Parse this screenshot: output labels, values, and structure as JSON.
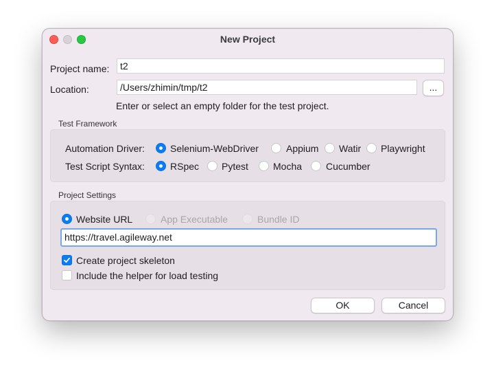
{
  "window": {
    "title": "New Project"
  },
  "form": {
    "project_name_label": "Project name:",
    "project_name_value": "t2",
    "location_label": "Location:",
    "location_value": "/Users/zhimin/tmp/t2",
    "browse_label": "...",
    "hint": "Enter or select an empty folder for the test project."
  },
  "test_framework": {
    "title": "Test Framework",
    "driver_label": "Automation Driver:",
    "drivers": [
      "Selenium-WebDriver",
      "Appium",
      "Watir",
      "Playwright"
    ],
    "selected_driver": "Selenium-WebDriver",
    "syntax_label": "Test Script Syntax:",
    "syntaxes": [
      "RSpec",
      "Pytest",
      "Mocha",
      "Cucumber"
    ],
    "selected_syntax": "RSpec"
  },
  "project_settings": {
    "title": "Project Settings",
    "targets": [
      {
        "label": "Website URL",
        "enabled": true,
        "selected": true
      },
      {
        "label": "App Executable",
        "enabled": false,
        "selected": false
      },
      {
        "label": "Bundle ID",
        "enabled": false,
        "selected": false
      }
    ],
    "url_value": "https://travel.agileway.net",
    "create_skeleton_label": "Create project skeleton",
    "create_skeleton_checked": true,
    "load_helper_label": "Include the helper for load testing",
    "load_helper_checked": false
  },
  "buttons": {
    "ok": "OK",
    "cancel": "Cancel"
  },
  "colors": {
    "accent": "#0a7cf6",
    "dialog_bg": "#f0eaf0",
    "close": "#ff5f57",
    "zoom": "#28c840"
  }
}
